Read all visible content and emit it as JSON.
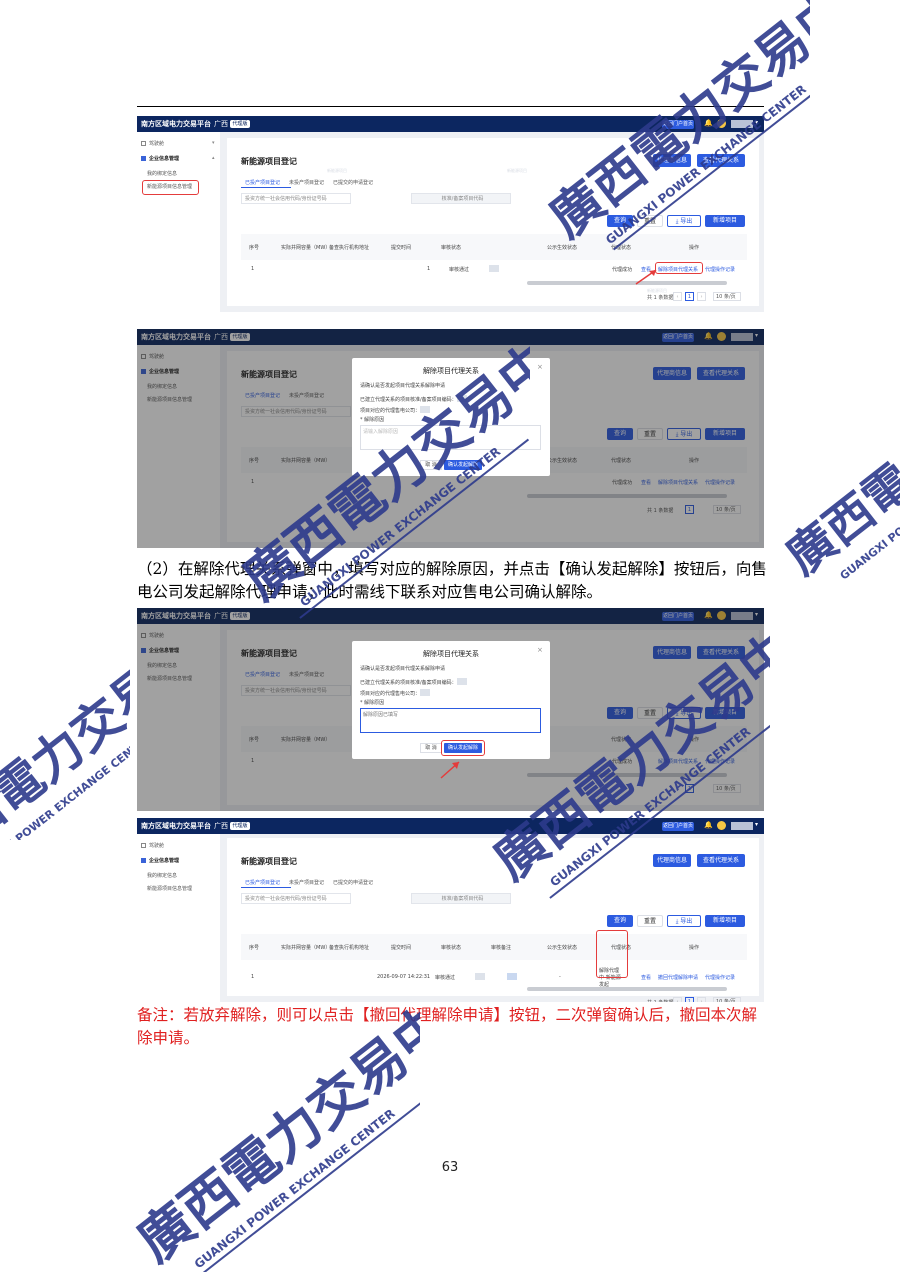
{
  "platform": {
    "name": "南方区域电力交易平台",
    "region": "广西",
    "env_tag": "代理版",
    "switch_button": "返回门户首页"
  },
  "sidebar": [
    {
      "label": "驾驶舱",
      "expanded": false
    },
    {
      "label": "企业信息管理",
      "expanded": true,
      "children": [
        "我的绑定信息",
        "新能源项目信息管理"
      ]
    }
  ],
  "page": {
    "title": "新能源项目登记",
    "top_buttons": [
      "代理商信息",
      "查看代理关系"
    ],
    "tabs": [
      "已投产项目登记",
      "未投产项目登记",
      "已提交的申请登记"
    ],
    "filter_placeholders": [
      "投资方统一社会信用代码/身份证号码",
      "核准/备案项目代码"
    ],
    "action_buttons": [
      "查询",
      "重置",
      "导出",
      "新增项目"
    ],
    "columns": [
      "序号",
      "项目名称",
      "实际并网容量（MW）",
      "备查执行机构地址",
      "提交时间",
      "审核状态",
      "审核备注",
      "公示生效状态",
      "代理状态",
      "操作"
    ],
    "row": {
      "index": "1",
      "submit_count": "1",
      "submit_time": "2026-09-07 14:22:31",
      "audit_status": "审核通过",
      "dash": "-",
      "agency_status_success": "代理成功",
      "agency_status_pending": "解除代理中-新能源发起",
      "ops_view": "查看",
      "ops_release": "解除项目代理关系",
      "ops_record": "代理操作记录",
      "ops_revoke": "撤回代理解除申请"
    },
    "pagination": {
      "total": "共 1 条数据",
      "page": "1",
      "per_page": "10 条/页"
    },
    "watermark": "新能源项目"
  },
  "dialog": {
    "title": "解除项目代理关系",
    "close": "×",
    "intro": "请确认是否发起项目代理关系解除申请",
    "project_line": "已建立代理关系的项目核准/备案项目编码：",
    "company_line": "项目对应的代理售电公司：",
    "reason_label": "* 解除原因",
    "reason_placeholder": "请输入解除原因",
    "reason_filled": "解除原因已填写",
    "cancel": "取 消",
    "confirm": "确认发起解除"
  },
  "text": {
    "step2": "（2）在解除代理关系弹窗中，填写对应的解除原因，并点击【确认发起解除】按钮后，向售电公司发起解除代理申请；此时需线下联系对应售电公司确认解除。",
    "note": "备注：若放弃解除，则可以点击【撤回代理解除申请】按钮，二次弹窗确认后，撤回本次解除申请。"
  },
  "page_number": "63",
  "seal": {
    "name_cn": "廣西電力交易中心",
    "name_en": "GUANGXI POWER EXCHANGE CENTER"
  }
}
